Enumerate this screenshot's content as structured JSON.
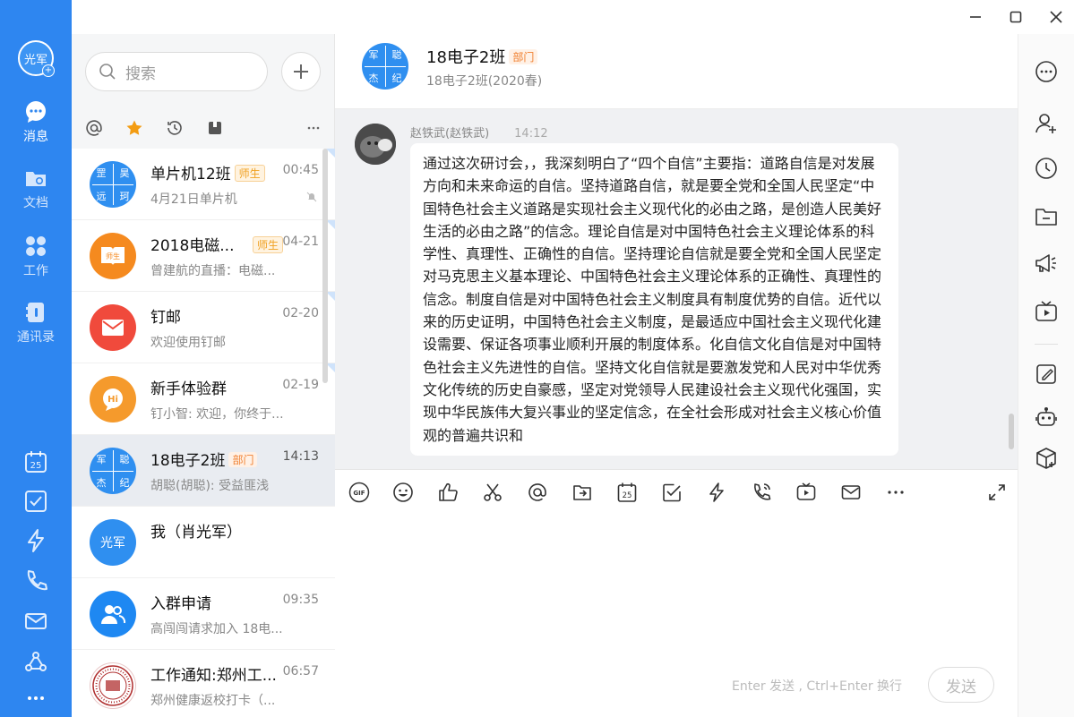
{
  "user": {
    "avatar_text": "光军"
  },
  "nav": [
    {
      "id": "messages",
      "label": "消息"
    },
    {
      "id": "docs",
      "label": "文档"
    },
    {
      "id": "work",
      "label": "工作"
    },
    {
      "id": "contacts",
      "label": "通讯录"
    }
  ],
  "search": {
    "placeholder": "搜索"
  },
  "conversations": [
    {
      "avatar": [
        "罡",
        "昊",
        "远",
        "珂"
      ],
      "name": "单片机12班",
      "badge": "师生",
      "time": "00:45",
      "preview": "4月21日单片机"
    },
    {
      "avatar_text": "师生",
      "name": "2018电磁...",
      "badge": "师生",
      "time": "04-21",
      "preview": "曾建航的直播：电磁..."
    },
    {
      "name": "钉邮",
      "time": "02-20",
      "preview": "欢迎使用钉邮"
    },
    {
      "avatar_text": "Hi",
      "name": "新手体验群",
      "time": "02-19",
      "preview": "钉小智: 欢迎，你终于..."
    },
    {
      "avatar": [
        "军",
        "聪",
        "杰",
        "纪"
      ],
      "name": "18电子2班",
      "badge": "部门",
      "time": "14:13",
      "preview": "胡聪(胡聪): 受益匪浅"
    },
    {
      "avatar_text": "光军",
      "name": "我（肖光军）",
      "time": "",
      "preview": ""
    },
    {
      "name": "入群申请",
      "time": "09:35",
      "preview": "高闯闯请求加入 18电..."
    },
    {
      "name": "工作通知:郑州工...",
      "time": "06:57",
      "preview": "郑州健康返校打卡（..."
    }
  ],
  "chat": {
    "avatar": [
      "军",
      "聪",
      "杰",
      "纪"
    ],
    "title": "18电子2班",
    "badge": "部门",
    "subtitle": "18电子2班(2020春)"
  },
  "message": {
    "sender": "赵铁武(赵铁武)",
    "time": "14:12",
    "text": "通过这次研讨会，，我深刻明白了“四个自信”主要指：道路自信是对发展方向和未来命运的自信。坚持道路自信，就是要全党和全国人民坚定“中国特色社会主义道路是实现社会主义现代化的必由之路，是创造人民美好生活的必由之路”的信念。理论自信是对中国特色社会主义理论体系的科学性、真理性、正确性的自信。坚持理论自信就是要全党和全国人民坚定对马克思主义基本理论、中国特色社会主义理论体系的正确性、真理性的信念。制度自信是对中国特色社会主义制度具有制度优势的自信。近代以来的历史证明，中国特色社会主义制度，是最适应中国社会主义现代化建设需要、保证各项事业顺利开展的制度体系。化自信文化自信是对中国特色社会主义先进性的自信。坚持文化自信就是要激发党和人民对中华优秀文化传统的历史自豪感，坚定对党领导人民建设社会主义现代化强国，实现中华民族伟大复兴事业的坚定信念，在全社会形成对社会主义核心价值观的普遍共识和"
  },
  "composer": {
    "gif_label": "GIF",
    "calendar_day": "25",
    "hint": "Enter 发送 , Ctrl+Enter 换行",
    "send_label": "发送"
  },
  "rail_calendar_day": "25",
  "colors": {
    "brand": "#2e86f0",
    "badge_orange": "#f0a020"
  }
}
